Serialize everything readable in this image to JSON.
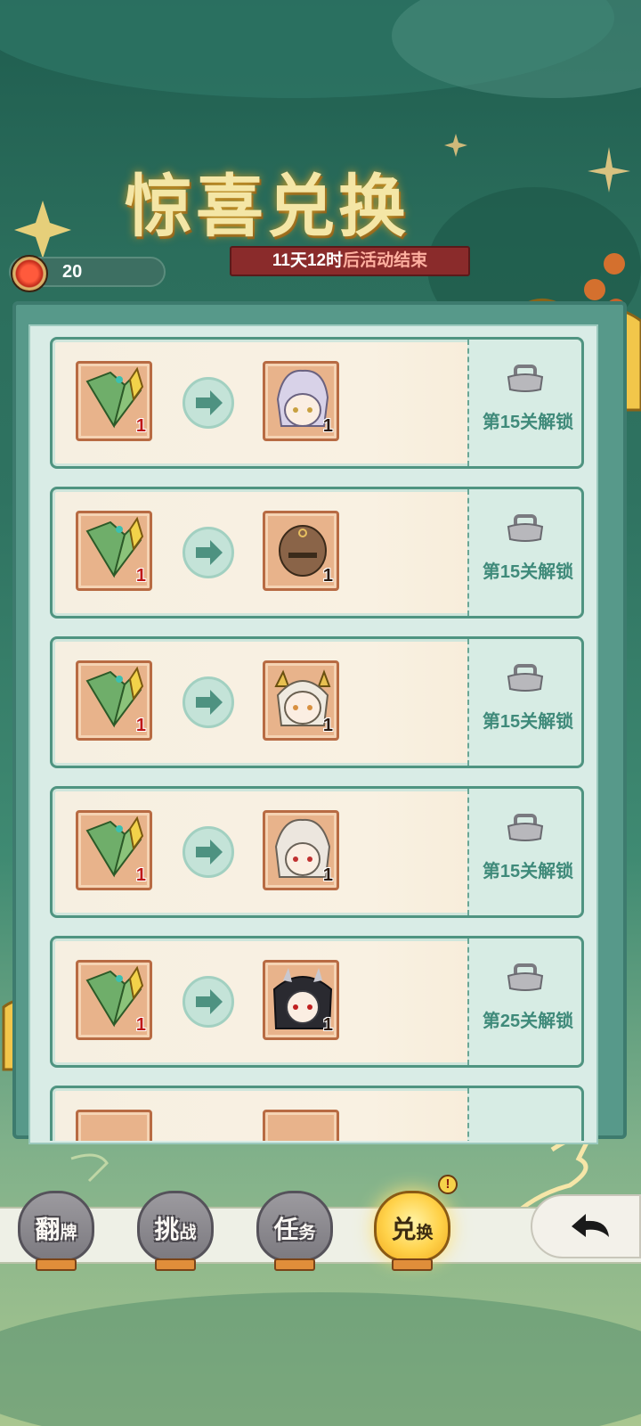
{
  "header": {
    "title": "惊喜兑换",
    "timer": {
      "days": "11天",
      "hours": "12时",
      "suffix": "后活动结束"
    }
  },
  "currency": {
    "icon": "token-coin-icon",
    "amount": "20"
  },
  "exchange_items": [
    {
      "cost_icon": "jade-fan-icon",
      "cost_count": "1",
      "reward_icon": "silver-hair-character-avatar",
      "reward_count": "1",
      "unlock_text": "第15关解锁",
      "lock_icon": "lock-icon"
    },
    {
      "cost_icon": "jade-fan-icon",
      "cost_count": "1",
      "reward_icon": "bald-monk-character-avatar",
      "reward_count": "1",
      "unlock_text": "第15关解锁",
      "lock_icon": "lock-icon"
    },
    {
      "cost_icon": "jade-fan-icon",
      "cost_count": "1",
      "reward_icon": "horned-white-hair-character-avatar",
      "reward_count": "1",
      "unlock_text": "第15关解锁",
      "lock_icon": "lock-icon"
    },
    {
      "cost_icon": "jade-fan-icon",
      "cost_count": "1",
      "reward_icon": "white-hair-elf-character-avatar",
      "reward_count": "1",
      "unlock_text": "第15关解锁",
      "lock_icon": "lock-icon"
    },
    {
      "cost_icon": "jade-fan-icon",
      "cost_count": "1",
      "reward_icon": "dark-hair-horned-character-avatar",
      "reward_count": "1",
      "unlock_text": "第25关解锁",
      "lock_icon": "lock-icon"
    }
  ],
  "nav": {
    "tabs": [
      {
        "label_main": "翻",
        "label_sub": "牌"
      },
      {
        "label_main": "挑",
        "label_sub": "战"
      },
      {
        "label_main": "任",
        "label_sub": "务"
      },
      {
        "label_main": "兑",
        "label_sub": "换"
      }
    ],
    "active_tab": 3,
    "alert_badge": "!",
    "back_icon": "back-arrow-icon"
  },
  "colors": {
    "accent": "#4f9481",
    "panel": "#d9ece6",
    "timer_bg": "#8a2b2b",
    "active_lantern": "#ffd24a"
  }
}
